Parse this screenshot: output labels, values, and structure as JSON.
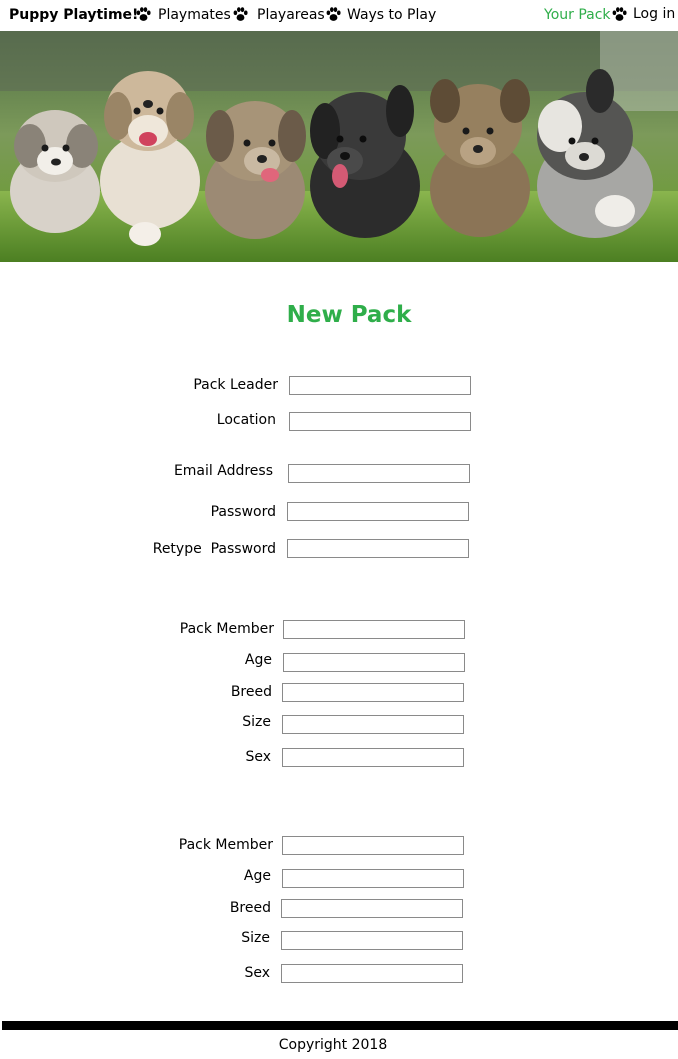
{
  "nav": {
    "brand": "Puppy Playtime!",
    "links": [
      "Playmates",
      "Playareas",
      "Ways to Play"
    ],
    "your_pack": "Your Pack",
    "login": "Log in"
  },
  "hero": {
    "icon": "puppies-photo"
  },
  "title": "New Pack",
  "leader": {
    "pack_leader": "Pack Leader",
    "location": "Location",
    "email": "Email Address",
    "password": "Password",
    "retype_password": "Retype  Password"
  },
  "members": [
    {
      "pack_member": "Pack Member",
      "age": "Age",
      "breed": "Breed",
      "size": "Size",
      "sex": "Sex"
    },
    {
      "pack_member": "Pack Member",
      "age": "Age",
      "breed": "Breed",
      "size": "Size",
      "sex": "Sex"
    }
  ],
  "footer": {
    "copyright": "Copyright 2018"
  },
  "colors": {
    "accent": "#2fae4a",
    "footer_bar": "#000000"
  }
}
